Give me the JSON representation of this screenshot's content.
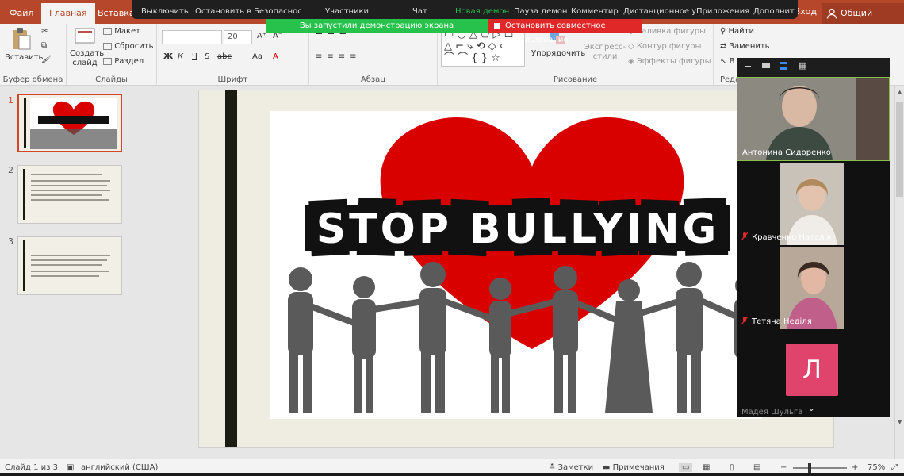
{
  "ribbon_tabs": [
    {
      "label": "Файл"
    },
    {
      "label": "Главная"
    },
    {
      "label": "Вставка"
    }
  ],
  "account": {
    "login": "Вход",
    "share": "Общий доступ"
  },
  "zoom_bar": {
    "items": [
      "Выключить",
      "Остановить в",
      "Безопаснос",
      "Участники",
      "Чат",
      "Новая демон",
      "Пауза демон",
      "Комментир",
      "Дистанционное у",
      "Приложения",
      "Дополнит"
    ],
    "notice": "Вы запустили демонстрацию экрана",
    "stop_label": "Остановить совместное использование"
  },
  "groups": {
    "clipboard": {
      "label": "Буфер обмена",
      "paste": "Вставить"
    },
    "slides": {
      "label": "Слайды",
      "new_slide": "Создать слайд",
      "layout": "Макет",
      "reset": "Сбросить",
      "section": "Раздел"
    },
    "font": {
      "label": "Шрифт",
      "size": "20",
      "buttons": [
        "Ж",
        "К",
        "Ч",
        "S",
        "abc",
        "Aa",
        "A"
      ]
    },
    "paragraph": {
      "label": "Абзац"
    },
    "drawing": {
      "label": "Рисование",
      "arrange": "Упорядочить",
      "quick_styles": "Экспресс-стили",
      "fill": "Заливка фигуры",
      "outline": "Контур фигуры",
      "effects": "Эффекты фигуры"
    },
    "editing": {
      "label": "Реда",
      "find": "Найти",
      "replace": "Заменить",
      "select": "В"
    }
  },
  "thumbnails": [
    {
      "num": "1"
    },
    {
      "num": "2"
    },
    {
      "num": "3"
    }
  ],
  "slide": {
    "headline": "STOP BULLYING"
  },
  "participants": [
    {
      "name": "Антонина Сидоренко"
    },
    {
      "name": "Кравченко Наталія"
    },
    {
      "name": "Тетяна Неділя"
    },
    {
      "name": "Мадея Шульга",
      "initial": "Л"
    }
  ],
  "status": {
    "slide_counter": "Слайд 1 из 3",
    "language": "английский (США)",
    "notes": "Заметки",
    "comments": "Примечания",
    "zoom": "75%"
  },
  "colors": {
    "accent": "#b7472a",
    "heart": "#d90000",
    "zoom_green": "#27c24c",
    "zoom_red": "#e02828",
    "avatar": "#e0436b"
  }
}
